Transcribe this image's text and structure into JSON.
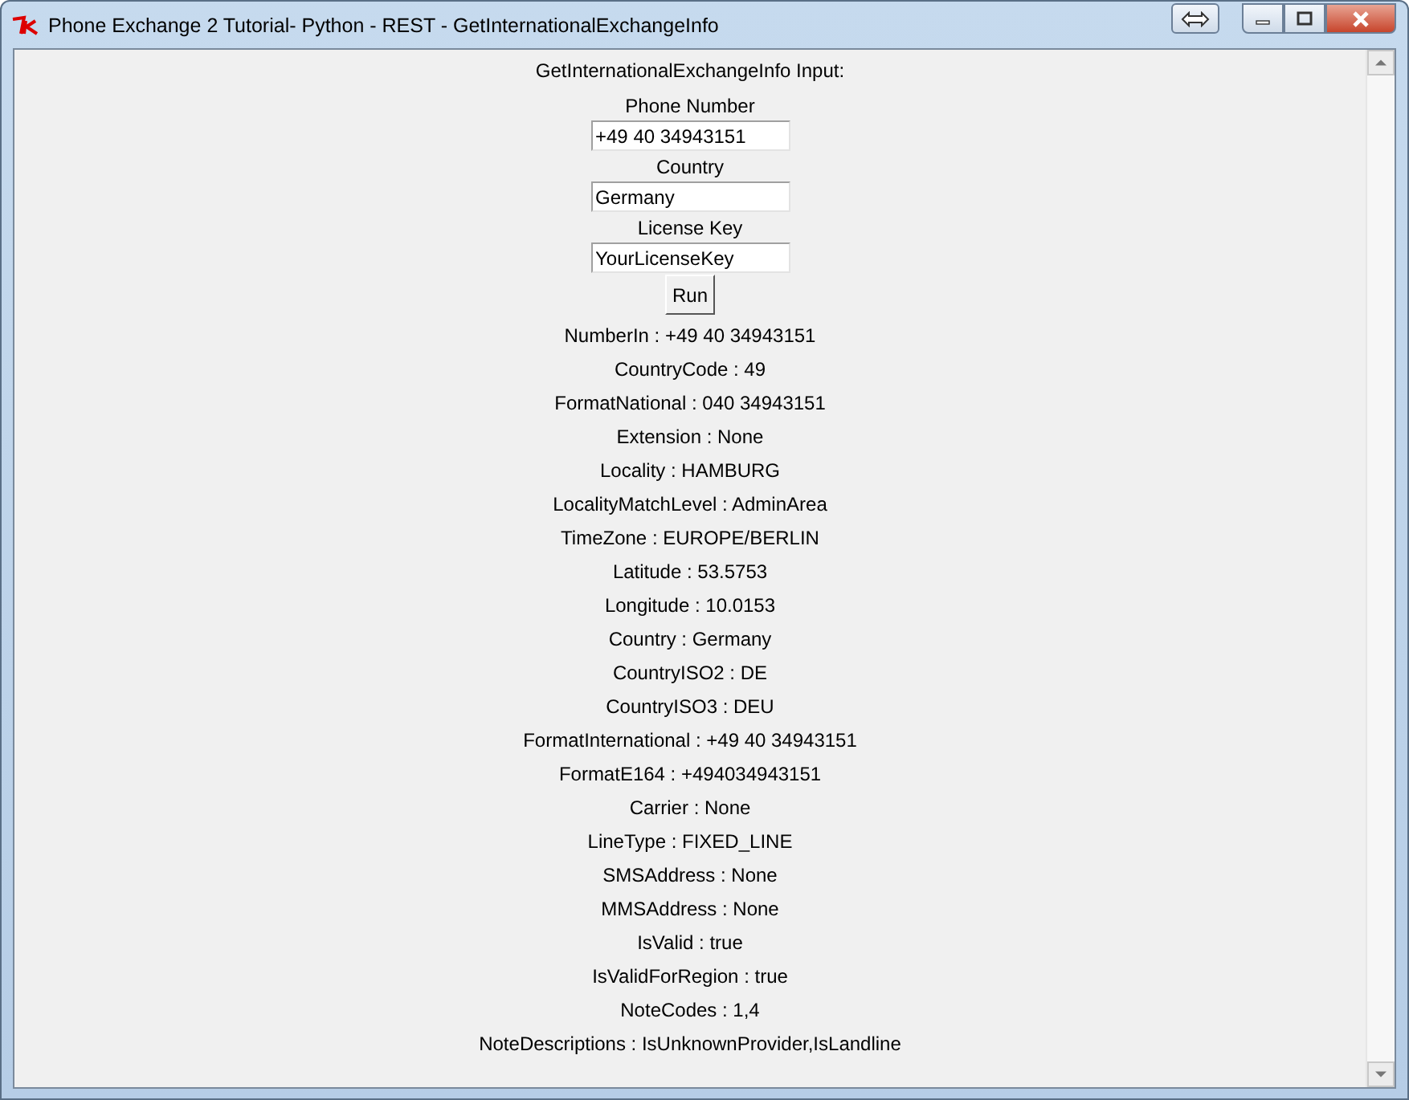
{
  "window": {
    "title": "Phone Exchange 2 Tutorial- Python - REST - GetInternationalExchangeInfo"
  },
  "heading": "GetInternationalExchangeInfo Input:",
  "fields": [
    {
      "label": "Phone Number",
      "value": "+49 40 34943151"
    },
    {
      "label": "Country",
      "value": "Germany"
    },
    {
      "label": "License Key",
      "value": "YourLicenseKey"
    }
  ],
  "run_button": "Run",
  "results": [
    "NumberIn : +49 40 34943151",
    "CountryCode : 49",
    "FormatNational : 040 34943151",
    "Extension : None",
    "Locality : HAMBURG",
    "LocalityMatchLevel : AdminArea",
    "TimeZone : EUROPE/BERLIN",
    "Latitude : 53.5753",
    "Longitude : 10.0153",
    "Country : Germany",
    "CountryISO2 : DE",
    "CountryISO3 : DEU",
    "FormatInternational : +49 40 34943151",
    "FormatE164 : +494034943151",
    "Carrier : None",
    "LineType : FIXED_LINE",
    "SMSAddress : None",
    "MMSAddress : None",
    "IsValid : true",
    "IsValidForRegion : true",
    "NoteCodes : 1,4",
    "NoteDescriptions : IsUnknownProvider,IsLandline"
  ]
}
